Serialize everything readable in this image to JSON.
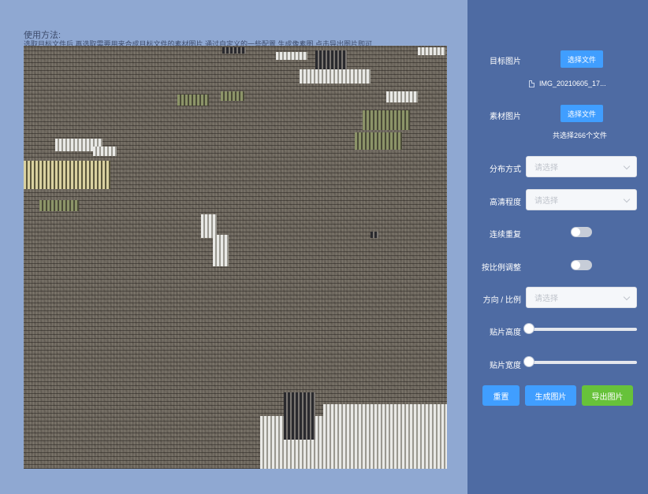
{
  "usage": {
    "title": "使用方法:",
    "description": "选取目标文件后,再选取需要用来合成目标文件的素材图片,通过自定义的一些配置,生成像素图,点击导出图片即可"
  },
  "panel": {
    "target": {
      "label": "目标图片",
      "button": "选择文件",
      "file_name": "IMG_20210605_17..."
    },
    "material": {
      "label": "素材图片",
      "button": "选择文件",
      "count_text": "共选择266个文件"
    },
    "distribution": {
      "label": "分布方式",
      "placeholder": "请选择"
    },
    "clarity": {
      "label": "高清程度",
      "placeholder": "请选择"
    },
    "continuous_repeat": {
      "label": "连续重复",
      "on": false
    },
    "proportional_adjust": {
      "label": "按比例调整",
      "on": false
    },
    "direction_ratio": {
      "label": "方向 / 比例",
      "placeholder": "请选择"
    },
    "tile_height": {
      "label": "贴片高度",
      "value": 0
    },
    "tile_width": {
      "label": "贴片宽度",
      "value": 0
    },
    "actions": {
      "reset": "重置",
      "generate": "生成图片",
      "export": "导出图片"
    }
  },
  "colors": {
    "left_bg": "#8fa8d2",
    "panel_bg": "#4e6ba3",
    "primary": "#409eff",
    "success": "#67c23a"
  }
}
